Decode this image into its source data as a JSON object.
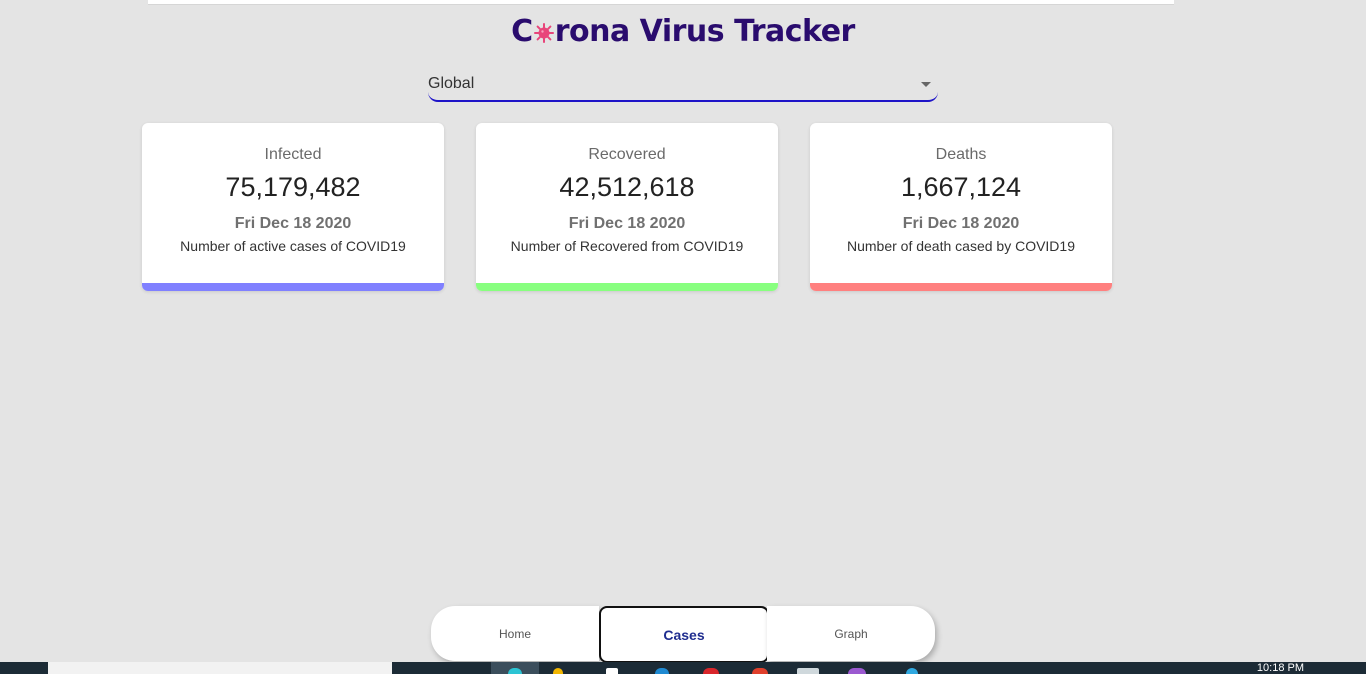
{
  "app": {
    "title_before": "C",
    "title_after": "rona Virus Tracker",
    "title_virus_icon": "virus-icon",
    "accent_color": "#2a0c6e"
  },
  "country_select": {
    "value": "Global"
  },
  "cards": [
    {
      "label": "Infected",
      "value": "75,179,482",
      "date": "Fri Dec 18 2020",
      "description": "Number of active cases of COVID19",
      "color": "#8080ff"
    },
    {
      "label": "Recovered",
      "value": "42,512,618",
      "date": "Fri Dec 18 2020",
      "description": "Number of Recovered from COVID19",
      "color": "#88ff7f"
    },
    {
      "label": "Deaths",
      "value": "1,667,124",
      "date": "Fri Dec 18 2020",
      "description": "Number of death cased by COVID19",
      "color": "#ff807f"
    }
  ],
  "bottom_nav": [
    {
      "label": "Home",
      "active": false
    },
    {
      "label": "Cases",
      "active": true
    },
    {
      "label": "Graph",
      "active": false
    }
  ],
  "taskbar": {
    "clock": "10:18 PM",
    "icons": [
      "edge-icon",
      "file-explorer-icon",
      "store-icon",
      "vscode-icon",
      "chrome-icon",
      "opera-icon",
      "notepad-icon",
      "discord-icon",
      "app-icon"
    ]
  }
}
